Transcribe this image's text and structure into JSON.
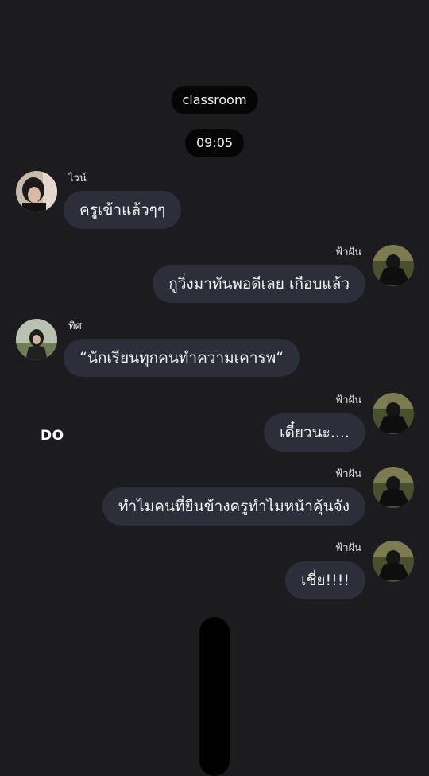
{
  "header": {
    "room_name": "classroom",
    "time": "09:05"
  },
  "messages": [
    {
      "sender": "ไวน์",
      "text": "ครูเข้าแล้วๆๆ",
      "side": "left"
    },
    {
      "sender": "ฟ้าฝัน",
      "text": "กูวิ่งมาทันพอดีเลย เกือบแล้ว",
      "side": "right"
    },
    {
      "sender": "ทิศ",
      "text": "“นักเรียนทุกคนทำความเคารพ“",
      "side": "left"
    },
    {
      "sender": "ฟ้าฝัน",
      "text": "เดี๋ยวนะ....",
      "side": "right"
    },
    {
      "sender": "ฟ้าฝัน",
      "text": "ทำไมคนที่ยืนข้างครูทำไมหน้าคุ้นจัง",
      "side": "right"
    },
    {
      "sender": "ฟ้าฝัน",
      "text": "เชี่ย!!!!",
      "side": "right"
    }
  ],
  "side_label": "DO",
  "colors": {
    "background": "#1c1c20",
    "bubble": "#2c2f39",
    "pill": "#050506"
  },
  "icons": {
    "avatar_wine": "avatar-photo",
    "avatar_fahfan": "avatar-photo",
    "avatar_tit": "avatar-photo"
  }
}
